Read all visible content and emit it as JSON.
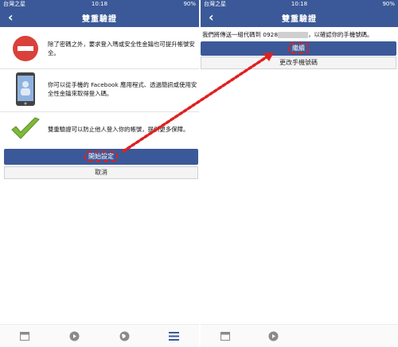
{
  "left": {
    "status": {
      "carrier": "台灣之星",
      "time": "10:18",
      "battery": "90%"
    },
    "nav": {
      "title": "雙重驗證",
      "back_icon": "chevron-left-icon"
    },
    "items": [
      {
        "icon": "no-entry-icon",
        "text": "除了密碼之外，要求登入瑪或安全性金鑰也可提升帳號安全。"
      },
      {
        "icon": "phone-icon",
        "text": "你可以從手機的 Facebook 應用程式、透過簡訊或使用安全性金鑰來取得登入碼。"
      },
      {
        "icon": "checkmark-icon",
        "text": "雙重驗證可以防止他人登入你的帳號，提供更多保障。"
      }
    ],
    "primary_button": "開始設定",
    "secondary_button": "取消"
  },
  "right": {
    "status": {
      "carrier": "台灣之星",
      "time": "10:18",
      "battery": "90%"
    },
    "nav": {
      "title": "雙重驗證"
    },
    "message_prefix": "我們將傳送一組代碼到 0928",
    "message_suffix": "，以確認你的手機號碼。",
    "primary_button": "繼續",
    "secondary_button": "更改手機號碼"
  },
  "tabbar": {
    "left_tabs": [
      "window-icon",
      "play-icon",
      "globe-icon",
      "menu-icon"
    ],
    "right_tabs": [
      "window-icon",
      "play-icon"
    ]
  },
  "colors": {
    "brand": "#3b5998",
    "highlight": "#e02020"
  }
}
